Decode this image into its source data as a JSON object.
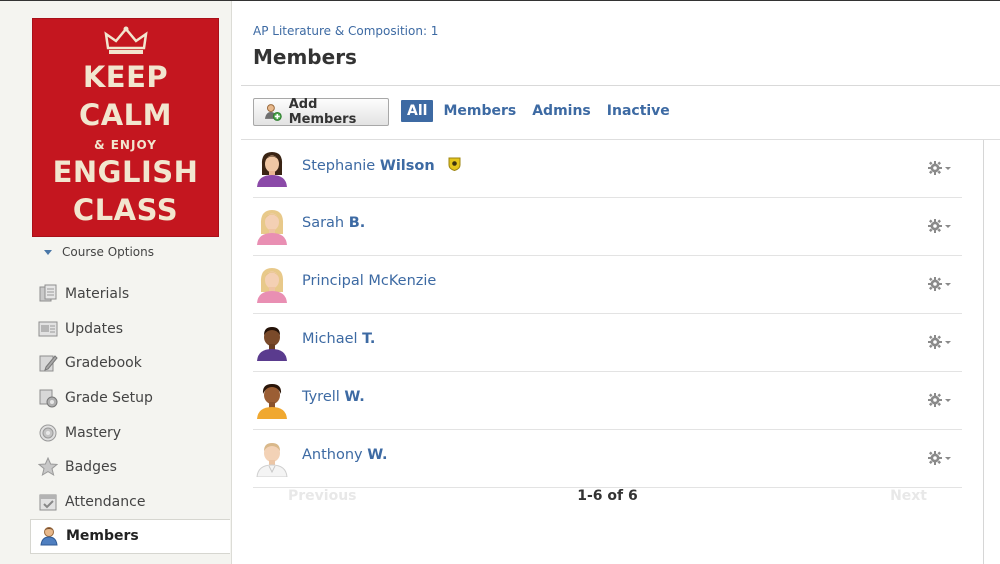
{
  "course": {
    "image_text": [
      "KEEP",
      "CALM",
      "& ENJOY",
      "ENGLISH",
      "CLASS"
    ],
    "options_label": "Course Options"
  },
  "sidebar": {
    "items": [
      {
        "label": "Materials",
        "icon": "materials-icon"
      },
      {
        "label": "Updates",
        "icon": "updates-icon"
      },
      {
        "label": "Gradebook",
        "icon": "gradebook-icon"
      },
      {
        "label": "Grade Setup",
        "icon": "grade-setup-icon"
      },
      {
        "label": "Mastery",
        "icon": "mastery-icon"
      },
      {
        "label": "Badges",
        "icon": "badges-icon"
      },
      {
        "label": "Attendance",
        "icon": "attendance-icon"
      },
      {
        "label": "Members",
        "icon": "members-icon",
        "active": true
      }
    ]
  },
  "header": {
    "breadcrumb": "AP Literature & Composition: 1",
    "title": "Members"
  },
  "toolbar": {
    "add_label": "Add Members",
    "filters": [
      "All",
      "Members",
      "Admins",
      "Inactive"
    ],
    "active_filter": "All"
  },
  "members": [
    {
      "first": "Stephanie",
      "last": "Wilson",
      "admin_badge": true
    },
    {
      "first": "Sarah",
      "last": "B."
    },
    {
      "first": "Principal McKenzie",
      "last": ""
    },
    {
      "first": "Michael",
      "last": "T."
    },
    {
      "first": "Tyrell",
      "last": "W."
    },
    {
      "first": "Anthony",
      "last": "W."
    }
  ],
  "pager": {
    "prev": "Previous",
    "count": "1-6 of 6",
    "next": "Next"
  },
  "colors": {
    "link": "#3d6aa3",
    "course_red": "#c4161f"
  }
}
